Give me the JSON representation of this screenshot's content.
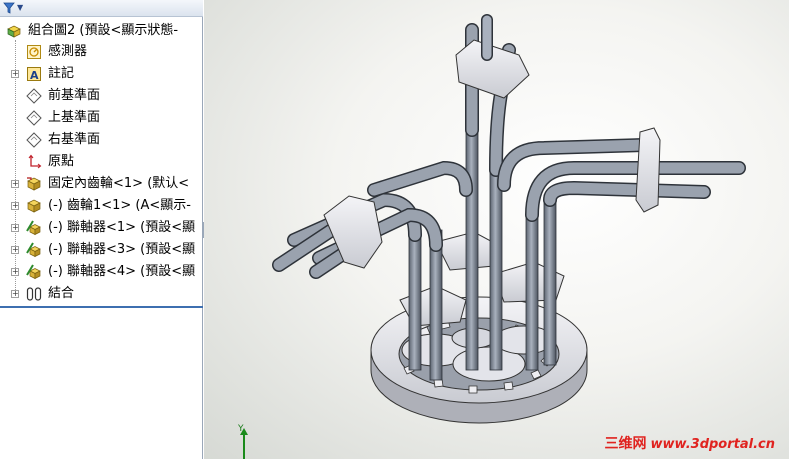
{
  "tree": {
    "filter_icon": "funnel-icon",
    "items": [
      {
        "label": "組合圖2 (預設<顯示狀態-",
        "icon": "assembly-icon",
        "expander": "−"
      },
      {
        "label": "感測器",
        "icon": "sensor-icon"
      },
      {
        "label": "註記",
        "icon": "annotation-icon",
        "expander": "+"
      },
      {
        "label": "前基準面",
        "icon": "plane-icon"
      },
      {
        "label": "上基準面",
        "icon": "plane-icon"
      },
      {
        "label": "右基準面",
        "icon": "plane-icon"
      },
      {
        "label": "原點",
        "icon": "origin-icon"
      },
      {
        "label": "固定內齒輪<1> (默认<",
        "icon": "part-icon",
        "expander": "+"
      },
      {
        "label": "(-) 齒輪1<1> (A<顯示-",
        "icon": "part-icon",
        "expander": "+"
      },
      {
        "label": "(-) 聯軸器<1> (預設<顯",
        "icon": "part-edit-icon",
        "expander": "+"
      },
      {
        "label": "(-) 聯軸器<3> (預設<顯",
        "icon": "part-edit-icon",
        "expander": "+"
      },
      {
        "label": "(-) 聯軸器<4> (預設<顯",
        "icon": "part-edit-icon",
        "expander": "+"
      },
      {
        "label": "結合",
        "icon": "mates-icon",
        "expander": "+"
      }
    ]
  },
  "viewport": {
    "triad_axis_label": "Y",
    "watermark_cn": "三维网",
    "watermark_url": "www.3dportal.cn"
  },
  "colors": {
    "accent": "#3d6fb0",
    "part_gray": "#8a92a0",
    "gear_light": "#e8e8ec",
    "watermark_red": "#e0231f"
  }
}
